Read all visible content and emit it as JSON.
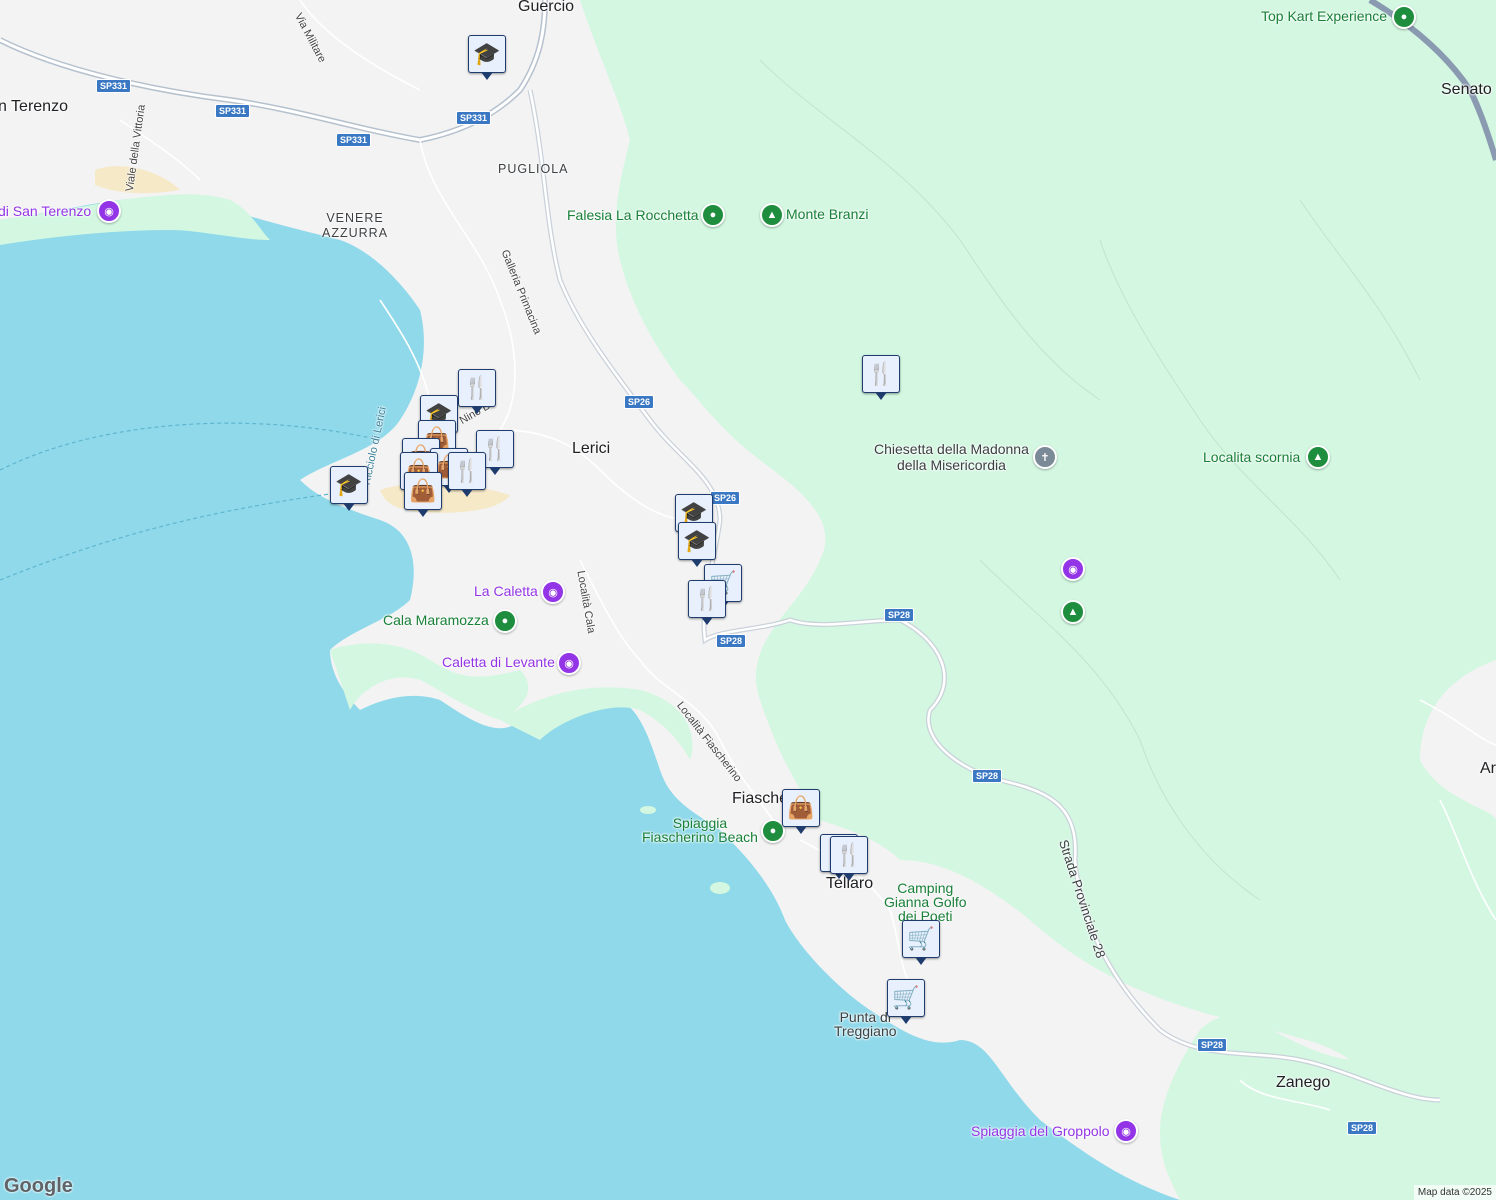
{
  "map": {
    "colors": {
      "water": "#8fd9ea",
      "land": "#f3f3f3",
      "park": "#d3f7e1",
      "road": "#ffffff",
      "major_road": "#b6c1ce",
      "shield": "#3a78c4"
    },
    "places": [
      {
        "id": "guercio",
        "name": "Guercio"
      },
      {
        "id": "san-terenzo",
        "name": "n Terenzo"
      },
      {
        "id": "pugliola",
        "name": "PUGLIOLA"
      },
      {
        "id": "venere-azzurra",
        "name": "VENERE\nAZZURRA"
      },
      {
        "id": "lerici",
        "name": "Lerici"
      },
      {
        "id": "fiascherino",
        "name": "Fiascherino"
      },
      {
        "id": "tellaro",
        "name": "Tellaro"
      },
      {
        "id": "zanego",
        "name": "Zanego"
      },
      {
        "id": "senato",
        "name": "Senato"
      },
      {
        "id": "ar",
        "name": "Ar"
      },
      {
        "id": "punta-treggiano",
        "name": "Punta di\nTreggiano"
      }
    ],
    "roads": [
      {
        "id": "via-militare",
        "name": "Via Militare"
      },
      {
        "id": "viale-vittoria",
        "name": "Viale della Vittoria"
      },
      {
        "id": "galleria-primacina",
        "name": "Galleria Primacina"
      },
      {
        "id": "localita-cala",
        "name": "Località Cala"
      },
      {
        "id": "localita-fiascherino",
        "name": "Località Fiascherino"
      },
      {
        "id": "strada-provinciale-28",
        "name": "Strada Provinciale 28"
      },
      {
        "id": "via-nino",
        "name": "Nino Be"
      },
      {
        "id": "ricciolo-lerici",
        "name": "Ricciolo di Lerici"
      }
    ],
    "route_shields": [
      "SP331",
      "SP331",
      "SP331",
      "SP26",
      "SP26",
      "SP28",
      "SP28",
      "SP28",
      "SP28",
      "SP28"
    ],
    "pois": [
      {
        "id": "top-kart",
        "name": "Top Kart Experience",
        "icon": "pin-icon",
        "color": "green"
      },
      {
        "id": "falesia",
        "name": "Falesia La Rocchetta",
        "icon": "pin-icon",
        "color": "green"
      },
      {
        "id": "monte-branzi",
        "name": "Monte Branzi",
        "icon": "tree-icon",
        "color": "green"
      },
      {
        "id": "chiesetta",
        "name": "Chiesetta della Madonna\ndella Misericordia",
        "icon": "cross-icon",
        "color": "grey"
      },
      {
        "id": "scornia",
        "name": "Localita scornia",
        "icon": "tree-icon",
        "color": "green"
      },
      {
        "id": "la-caletta",
        "name": "La Caletta",
        "icon": "camera-icon",
        "color": "purple"
      },
      {
        "id": "cala-maramozza",
        "name": "Cala Maramozza",
        "icon": "pin-icon",
        "color": "green"
      },
      {
        "id": "caletta-levante",
        "name": "Caletta di Levante",
        "icon": "camera-icon",
        "color": "purple"
      },
      {
        "id": "spiaggia-fiascherino",
        "name": "Spiaggia\nFiascherino Beach",
        "icon": "pin-icon",
        "color": "green"
      },
      {
        "id": "camping",
        "name": "Camping\nGianna Golfo\ndei Poeti",
        "icon": "",
        "color": "green"
      },
      {
        "id": "spiaggia-groppolo",
        "name": "Spiaggia del Groppolo",
        "icon": "camera-icon",
        "color": "purple"
      },
      {
        "id": "san-terenzo-poi",
        "name": "di San Terenzo",
        "icon": "camera-icon",
        "color": "purple"
      },
      {
        "id": "unnamed-camera",
        "name": "",
        "icon": "camera-icon",
        "color": "purple"
      },
      {
        "id": "unnamed-tree",
        "name": "",
        "icon": "tree-icon",
        "color": "green"
      }
    ],
    "markers": [
      {
        "id": "m1",
        "type": "school-icon",
        "glyph": "🎓"
      },
      {
        "id": "m2",
        "type": "restaurant-icon",
        "glyph": "🍴"
      },
      {
        "id": "m3",
        "type": "restaurant-icon",
        "glyph": "🍴"
      },
      {
        "id": "m4",
        "type": "school-icon",
        "glyph": "🎓"
      },
      {
        "id": "m5",
        "type": "shopping-bag-icon",
        "glyph": "👜"
      },
      {
        "id": "m6",
        "type": "school-icon",
        "glyph": "🎓"
      },
      {
        "id": "m7",
        "type": "school-icon",
        "glyph": "🎓"
      },
      {
        "id": "m8",
        "type": "cart-icon",
        "glyph": "🛒"
      },
      {
        "id": "m9",
        "type": "restaurant-icon",
        "glyph": "🍴"
      },
      {
        "id": "m10",
        "type": "shopping-bag-icon",
        "glyph": "👜"
      },
      {
        "id": "m11",
        "type": "restaurant-icon",
        "glyph": "🍴"
      },
      {
        "id": "m12",
        "type": "cart-icon",
        "glyph": "🛒"
      },
      {
        "id": "m13",
        "type": "cart-icon",
        "glyph": "🛒"
      },
      {
        "id": "m14",
        "type": "restaurant-icon",
        "glyph": "🍴"
      }
    ],
    "logo": "Google",
    "attribution": "Map data ©2025"
  }
}
